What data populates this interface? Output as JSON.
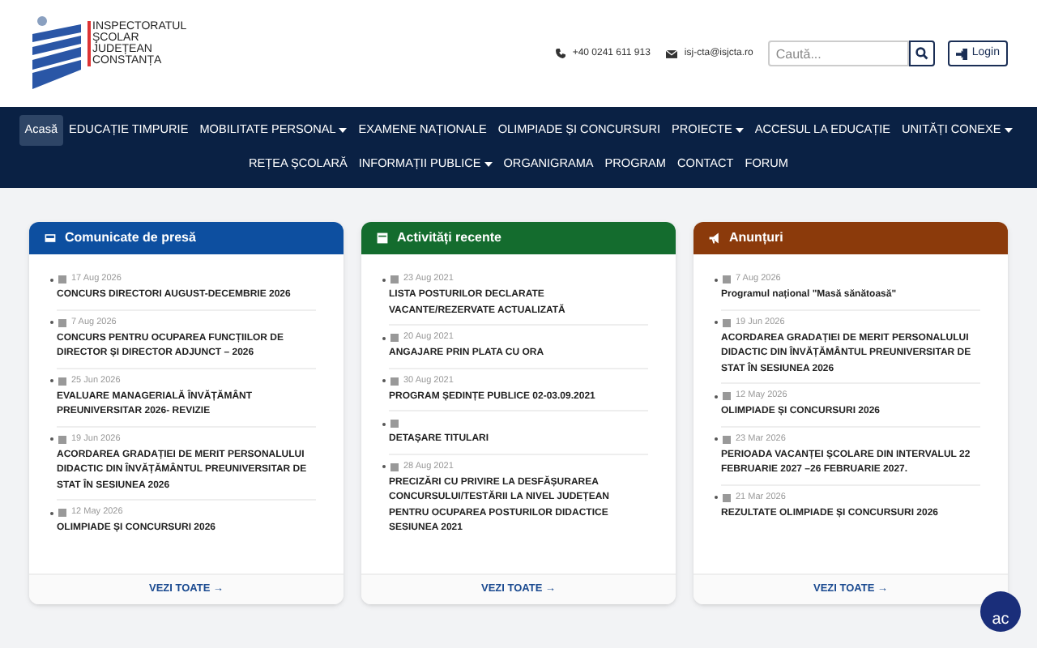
{
  "logo": {
    "lines": [
      "INSPECTORATUL",
      "ŞCOLAR",
      "JUDEȚEAN",
      "CONSTANȚA"
    ]
  },
  "contact": {
    "phone": "+40 0241 611 913",
    "email": "isj-cta@isjcta.ro"
  },
  "search": {
    "placeholder": "Caută..."
  },
  "login_button": {
    "label": "Login"
  },
  "nav_rows": [
    [
      {
        "label": "Acasă",
        "selected": true,
        "dropdown": false
      },
      {
        "label": "EDUCAȚIE TIMPURIE",
        "selected": false,
        "dropdown": false
      },
      {
        "label": "MOBILITATE PERSONAL",
        "selected": false,
        "dropdown": true
      },
      {
        "label": "EXAMENE NAȚIONALE",
        "selected": false,
        "dropdown": false
      },
      {
        "label": "OLIMPIADE ȘI CONCURSURI",
        "selected": false,
        "dropdown": false
      },
      {
        "label": "PROIECTE",
        "selected": false,
        "dropdown": true
      },
      {
        "label": "ACCESUL LA EDUCAȚIE",
        "selected": false,
        "dropdown": false
      },
      {
        "label": "UNITĂȚI CONEXE",
        "selected": false,
        "dropdown": true
      }
    ],
    [
      {
        "label": "REȚEA ȘCOLARĂ",
        "selected": false,
        "dropdown": false
      },
      {
        "label": "INFORMAȚII PUBLICE",
        "selected": false,
        "dropdown": true
      },
      {
        "label": "ORGANIGRAMA",
        "selected": false,
        "dropdown": false
      },
      {
        "label": "PROGRAM",
        "selected": false,
        "dropdown": false
      },
      {
        "label": "CONTACT",
        "selected": false,
        "dropdown": false
      },
      {
        "label": "FORUM",
        "selected": false,
        "dropdown": false
      }
    ]
  ],
  "cards": [
    {
      "title": "Comunicate de presă",
      "kind": "press",
      "color": "#0d4fa0",
      "link": "VEZI TOATE →",
      "items": [
        {
          "date": "17 Aug 2026",
          "title": "CONCURS DIRECTORI AUGUST-DECEMBRIE 2026"
        },
        {
          "date": "7 Aug 2026",
          "title": "CONCURS PENTRU OCUPAREA FUNCȚIILOR DE DIRECTOR ȘI DIRECTOR ADJUNCT – 2026"
        },
        {
          "date": "25 Jun 2026",
          "title": "EVALUARE MANAGERIALĂ ÎNVĂȚĂMÂNT PREUNIVERSITAR 2026- REVIZIE"
        },
        {
          "date": "19 Jun 2026",
          "title": "ACORDAREA GRADAȚIEI DE MERIT PERSONALULUI DIDACTIC DIN ÎNVĂȚĂMÂNTUL PREUNIVERSITAR DE STAT ÎN SESIUNEA 2026"
        },
        {
          "date": "12 May 2026",
          "title": "OLIMPIADE ȘI CONCURSURI 2026"
        }
      ]
    },
    {
      "title": "Activități recente",
      "kind": "activity",
      "color": "#146c2e",
      "link": "VEZI TOATE →",
      "items": [
        {
          "date": "23 Aug 2021",
          "title": "LISTA POSTURILOR DECLARATE VACANTE/REZERVATE ACTUALIZATĂ"
        },
        {
          "date": "20 Aug 2021",
          "title": "ANGAJARE PRIN PLATA CU ORA"
        },
        {
          "date": "30 Aug 2021",
          "title": "PROGRAM ȘEDINȚE PUBLICE 02-03.09.2021"
        },
        {
          "title": "DETAȘARE TITULARI"
        },
        {
          "date": "28 Aug 2021",
          "title": "PRECIZĂRI CU PRIVIRE LA DESFĂȘURAREA CONCURSULUI/TESTĂRII LA NIVEL JUDEȚEAN PENTRU OCUPAREA POSTURILOR DIDACTICE SESIUNEA 2021"
        }
      ]
    },
    {
      "title": "Anunțuri",
      "kind": "announce",
      "color": "#8b3a0b",
      "link": "VEZI TOATE →",
      "items": [
        {
          "date": "7 Aug 2026",
          "title": "Programul național \"Masă sănătoasă\""
        },
        {
          "date": "19 Jun 2026",
          "title": "ACORDAREA GRADAȚIEI DE MERIT PERSONALULUI DIDACTIC DIN ÎNVĂȚĂMÂNTUL PREUNIVERSITAR DE STAT ÎN SESIUNEA 2026"
        },
        {
          "date": "12 May 2026",
          "title": "OLIMPIADE ȘI CONCURSURI 2026"
        },
        {
          "date": "23 Mar 2026",
          "title": "PERIOADA VACANȚEI ȘCOLARE DIN INTERVALUL 22 FEBRUARIE 2027 –26 FEBRUARIE 2027."
        },
        {
          "date": "21 Mar 2026",
          "title": "REZULTATE OLIMPIADE ȘI CONCURSURI 2026"
        }
      ]
    }
  ],
  "accessibility_button": {
    "label": "ac"
  }
}
